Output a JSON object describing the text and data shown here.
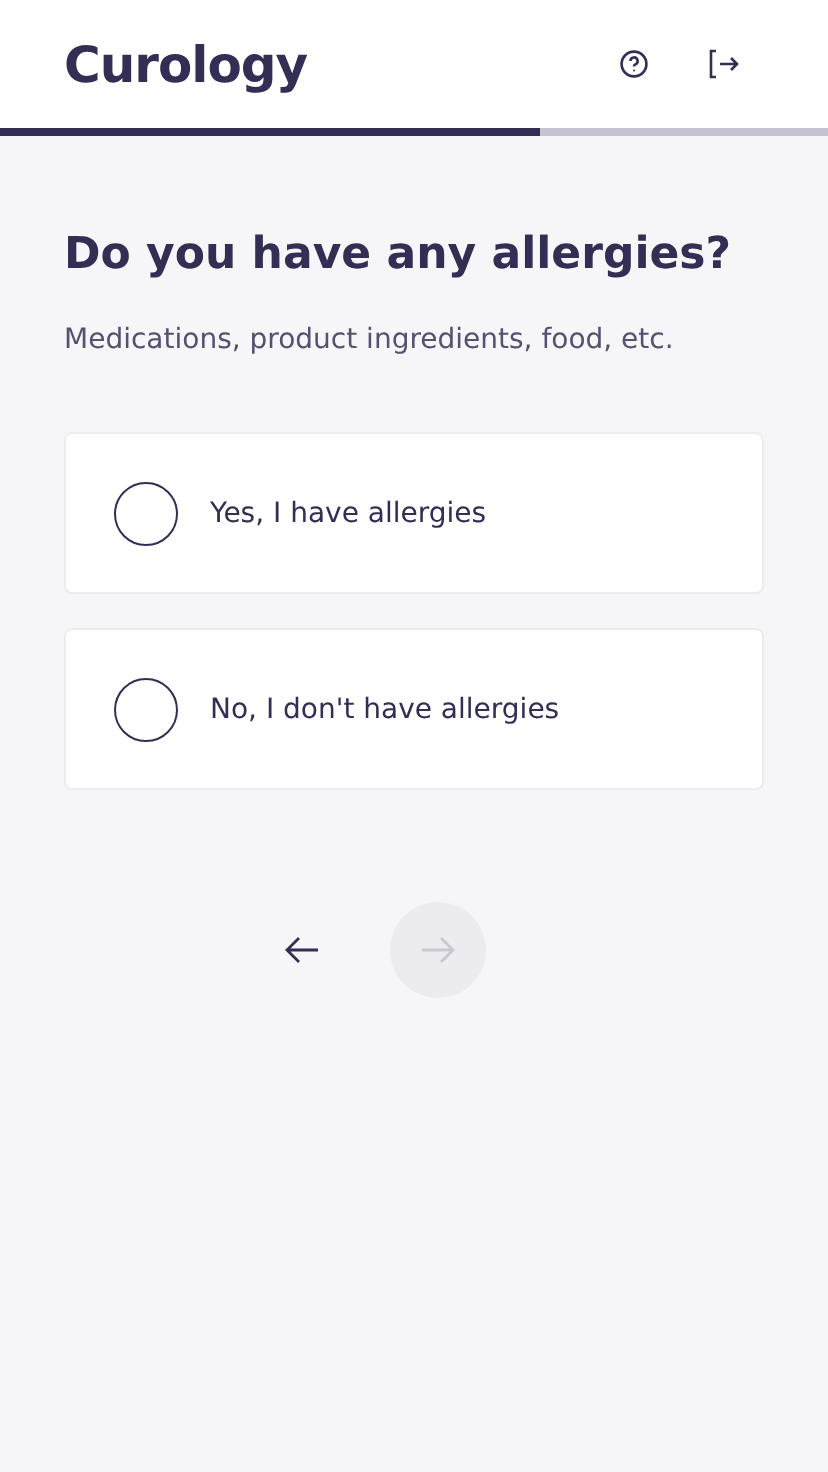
{
  "header": {
    "logo": "Curology"
  },
  "progress": {
    "level": 0.652
  },
  "question": {
    "title": "Do you have any allergies?",
    "subtitle": "Medications, product ingredients, food, etc."
  },
  "options": [
    {
      "label": "Yes, I have allergies",
      "selected": false
    },
    {
      "label": "No, I don't have allergies",
      "selected": false
    }
  ],
  "navigation": {
    "next_disabled": true
  }
}
